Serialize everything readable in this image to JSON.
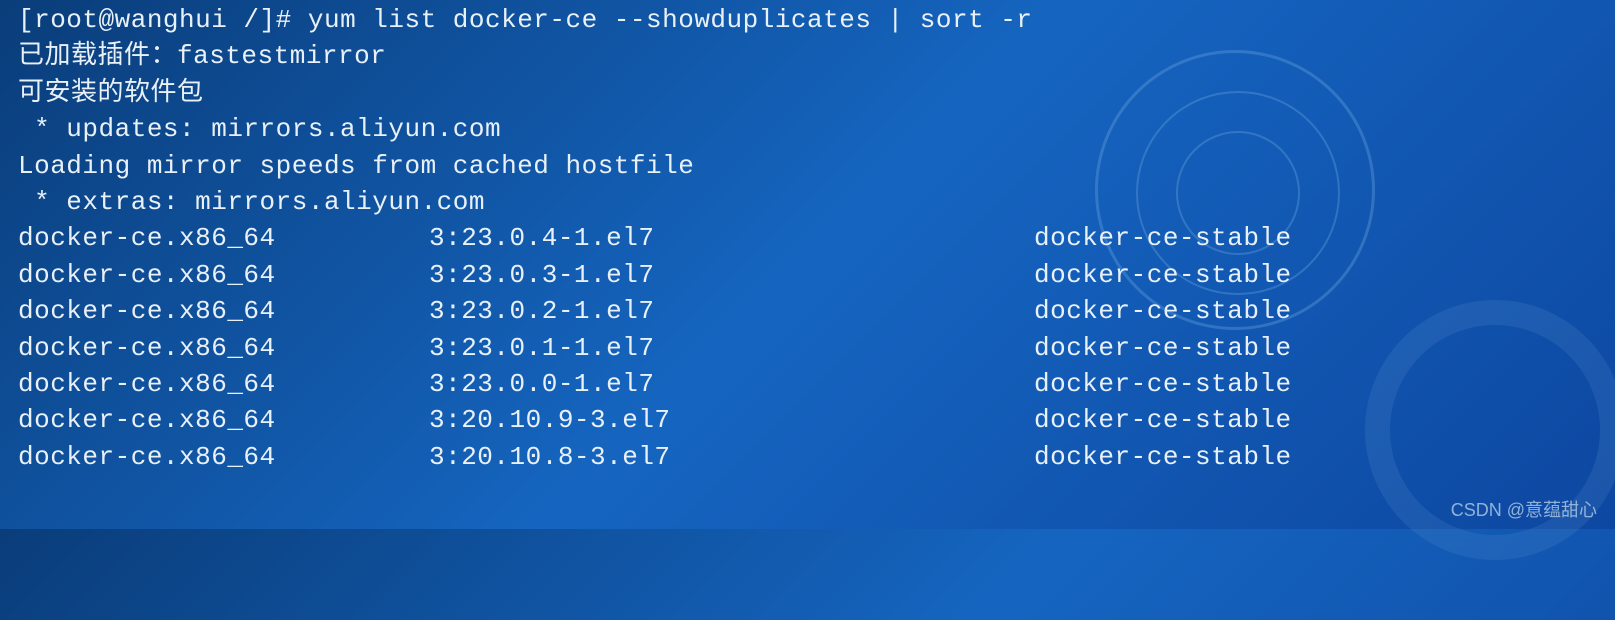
{
  "terminal": {
    "prompt": "[root@wanghui /]# ",
    "command": "yum list docker-ce --showduplicates | sort -r",
    "line_plugins": "已加载插件：fastestmirror",
    "line_installable": "可安装的软件包",
    "line_updates": " * updates: mirrors.aliyun.com",
    "line_loading": "Loading mirror speeds from cached hostfile",
    "line_extras": " * extras: mirrors.aliyun.com",
    "packages": [
      {
        "name": "docker-ce.x86_64",
        "version": "3:23.0.4-1.el7",
        "repo": "docker-ce-stable"
      },
      {
        "name": "docker-ce.x86_64",
        "version": "3:23.0.3-1.el7",
        "repo": "docker-ce-stable"
      },
      {
        "name": "docker-ce.x86_64",
        "version": "3:23.0.2-1.el7",
        "repo": "docker-ce-stable"
      },
      {
        "name": "docker-ce.x86_64",
        "version": "3:23.0.1-1.el7",
        "repo": "docker-ce-stable"
      },
      {
        "name": "docker-ce.x86_64",
        "version": "3:23.0.0-1.el7",
        "repo": "docker-ce-stable"
      },
      {
        "name": "docker-ce.x86_64",
        "version": "3:20.10.9-3.el7",
        "repo": "docker-ce-stable"
      },
      {
        "name": "docker-ce.x86_64",
        "version": "3:20.10.8-3.el7",
        "repo": "docker-ce-stable"
      }
    ]
  },
  "watermark": "CSDN @意蕴甜心"
}
